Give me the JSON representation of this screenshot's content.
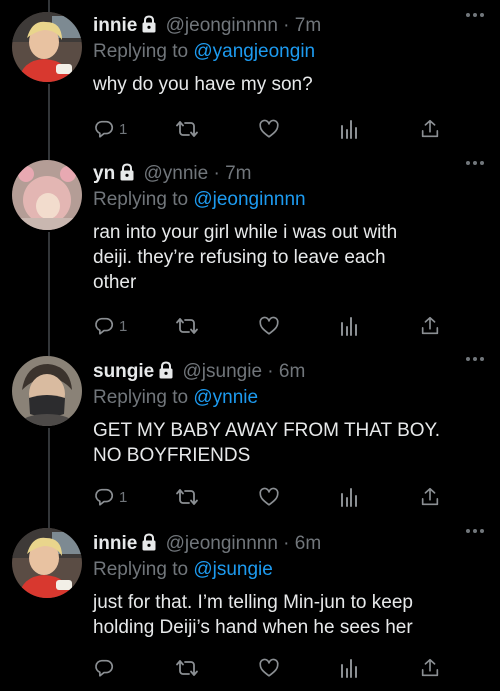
{
  "tweets": [
    {
      "name": "innie",
      "handle": "@jeonginnnn",
      "sep": "·",
      "time": "7m",
      "reply_prefix": "Replying to",
      "reply_to": "@yangjeongin",
      "text_lines": [
        "why do you have my son?"
      ],
      "reply_count": "1",
      "avatar": "avatar-innie"
    },
    {
      "name": "yn",
      "handle": "@ynnie",
      "sep": "·",
      "time": "7m",
      "reply_prefix": "Replying to",
      "reply_to": "@jeonginnnn",
      "text_lines": [
        "ran into your girl while i was out with",
        "deiji. they’re refusing to leave each",
        "other"
      ],
      "reply_count": "1",
      "avatar": "avatar-yn"
    },
    {
      "name": "sungie",
      "handle": "@jsungie",
      "sep": "·",
      "time": "6m",
      "reply_prefix": "Replying to",
      "reply_to": "@ynnie",
      "text_lines": [
        "GET MY BABY AWAY FROM THAT BOY.",
        "NO BOYFRIENDS"
      ],
      "reply_count": "1",
      "avatar": "avatar-sungie"
    },
    {
      "name": "innie",
      "handle": "@jeonginnnn",
      "sep": "·",
      "time": "6m",
      "reply_prefix": "Replying to",
      "reply_to": "@jsungie",
      "text_lines": [
        "just for that. I’m telling Min-jun to keep",
        "holding Deiji’s hand when he sees her"
      ],
      "reply_count": "",
      "avatar": "avatar-innie"
    }
  ],
  "icons": {
    "reply": "reply-icon",
    "retweet": "retweet-icon",
    "like": "like-icon",
    "views": "views-icon",
    "share": "share-icon",
    "more": "more-icon",
    "lock": "lock-icon"
  },
  "colors": {
    "background": "#000000",
    "text": "#e7e9ea",
    "muted": "#71767b",
    "link": "#1d9bf0",
    "thread_line": "#333639"
  }
}
